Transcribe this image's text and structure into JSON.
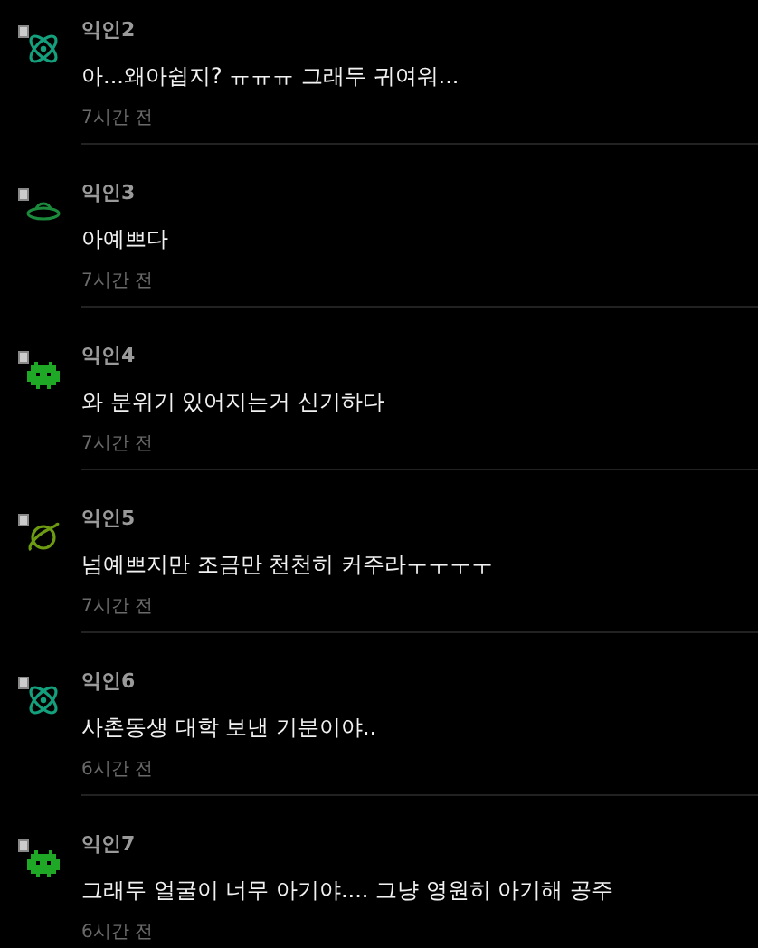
{
  "comments": [
    {
      "author": "익인2",
      "text": "아...왜아쉽지? ㅠㅠㅠ 그래두 귀여워...",
      "time": "7시간 전",
      "avatar": {
        "kind": "atom",
        "color": "#14a07c"
      }
    },
    {
      "author": "익인3",
      "text": "아예쁘다",
      "time": "7시간 전",
      "avatar": {
        "kind": "ufo",
        "color": "#1b8a3c"
      }
    },
    {
      "author": "익인4",
      "text": "와 분위기 있어지는거 신기하다",
      "time": "7시간 전",
      "avatar": {
        "kind": "invader",
        "color": "#1fa826"
      }
    },
    {
      "author": "익인5",
      "text": "넘예쁘지만 조금만 천천히 커주라ㅜㅜㅜㅜ",
      "time": "7시간 전",
      "avatar": {
        "kind": "planet",
        "color": "#6c9a12"
      }
    },
    {
      "author": "익인6",
      "text": "사촌동생 대학 보낸 기분이야..",
      "time": "6시간 전",
      "avatar": {
        "kind": "atom",
        "color": "#14a07c"
      }
    },
    {
      "author": "익인7",
      "text": "그래두 얼굴이 너무 아기야.... 그냥 영원히 아기해 공주",
      "time": "6시간 전",
      "avatar": {
        "kind": "invader",
        "color": "#1fa826"
      }
    }
  ]
}
